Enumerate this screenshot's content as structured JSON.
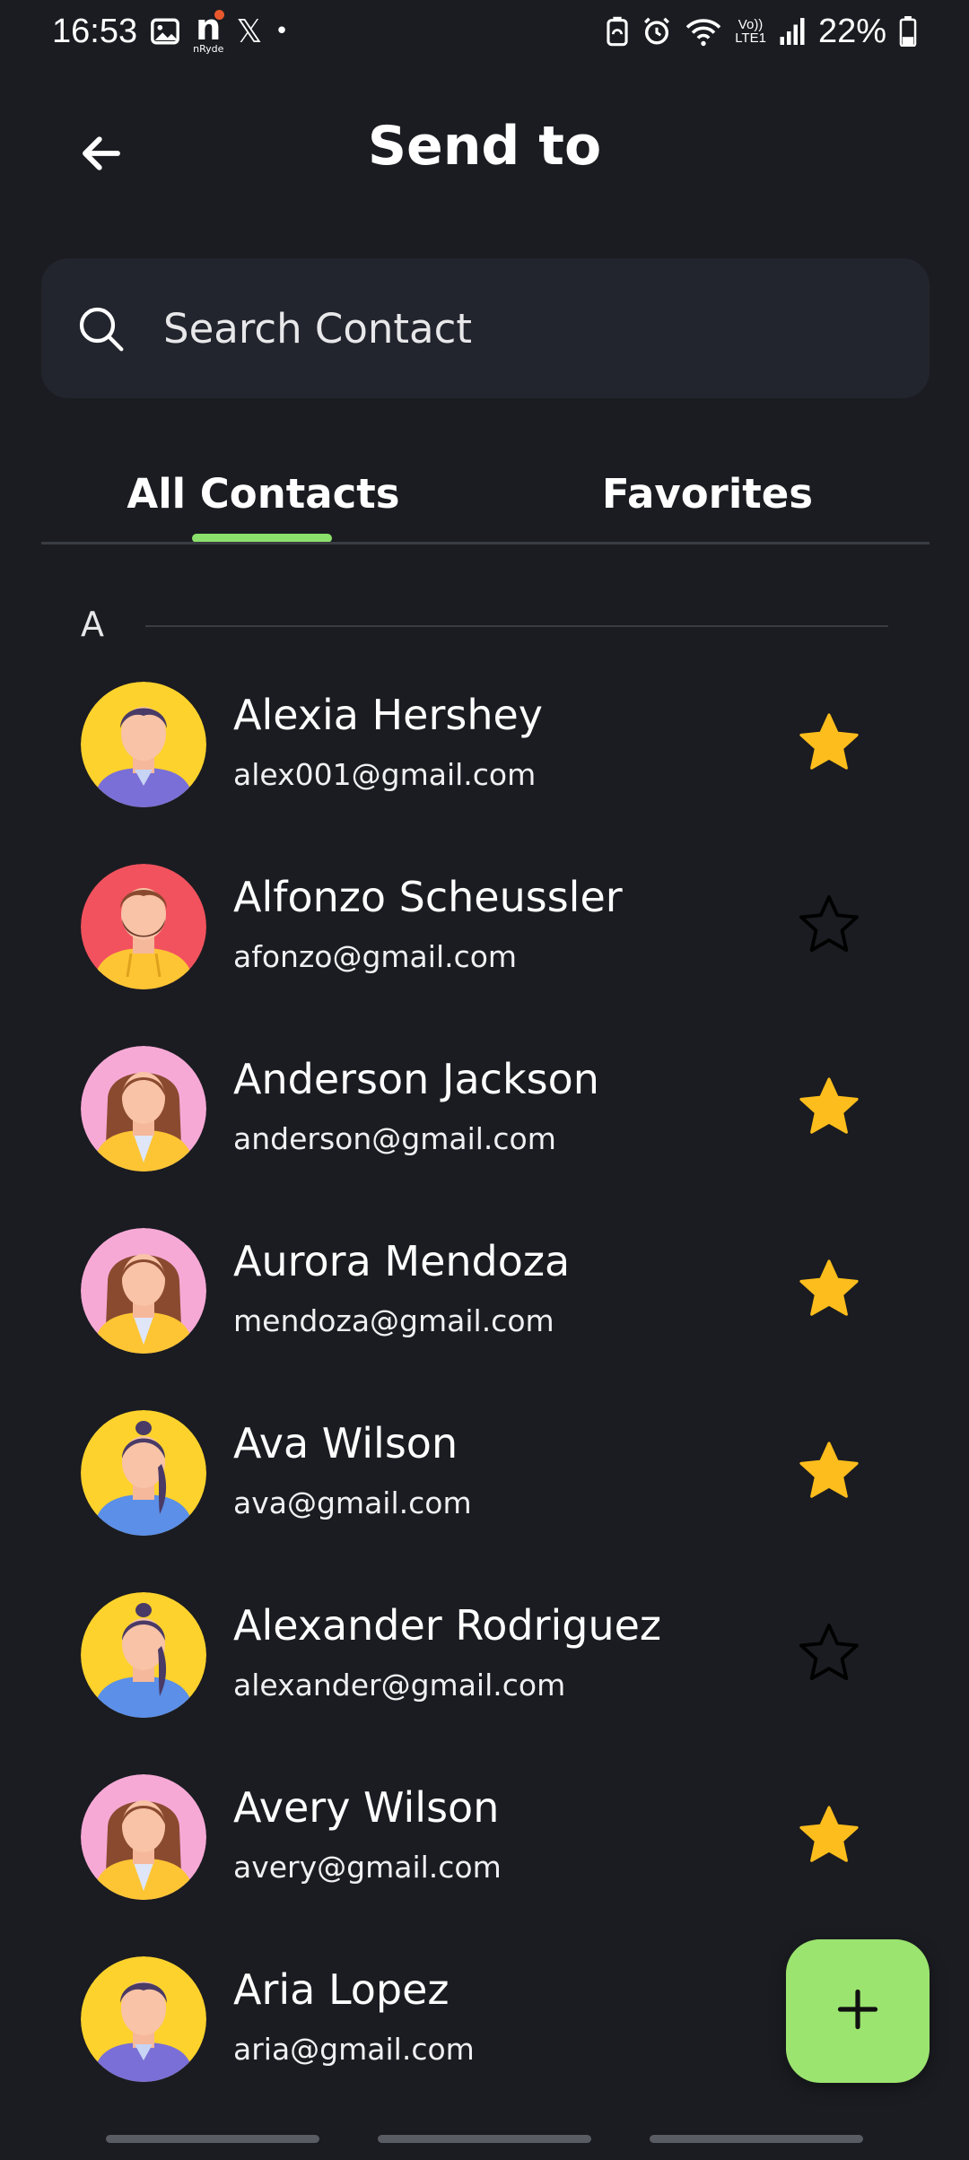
{
  "status_bar": {
    "time": "16:53",
    "nryde_letter": "n",
    "nryde_label": "nRyde",
    "x_label": "𝕏",
    "dot": "•",
    "network_label_top": "Vo))",
    "network_label_bottom": "LTE1",
    "battery_percent": "22%",
    "icons": [
      "gallery-icon",
      "nryde-app-icon",
      "x-app-icon",
      "notification-dot-icon",
      "battery-saver-icon",
      "alarm-icon",
      "wifi-icon",
      "volte-icon",
      "signal-icon",
      "battery-icon"
    ]
  },
  "header": {
    "title": "Send to",
    "back_icon": "arrow-left-icon"
  },
  "search": {
    "placeholder": "Search Contact",
    "value": "",
    "icon": "search-icon"
  },
  "tabs": [
    {
      "label": "All Contacts",
      "active": true
    },
    {
      "label": "Favorites",
      "active": false
    }
  ],
  "section": {
    "letter": "A"
  },
  "contacts": [
    {
      "name": "Alexia Hershey",
      "email": "alex001@gmail.com",
      "favorite": true,
      "avatar": "man-purple-shirt-avatar"
    },
    {
      "name": "Alfonzo Scheussler",
      "email": "afonzo@gmail.com",
      "favorite": false,
      "avatar": "bearded-man-yellow-hoodie-avatar"
    },
    {
      "name": "Anderson Jackson",
      "email": "anderson@gmail.com",
      "favorite": true,
      "avatar": "woman-yellow-jacket-avatar"
    },
    {
      "name": "Aurora Mendoza",
      "email": "mendoza@gmail.com",
      "favorite": true,
      "avatar": "woman-yellow-jacket-avatar"
    },
    {
      "name": "Ava Wilson",
      "email": "ava@gmail.com",
      "favorite": true,
      "avatar": "woman-ponytail-blue-shirt-avatar"
    },
    {
      "name": "Alexander Rodriguez",
      "email": "alexander@gmail.com",
      "favorite": false,
      "avatar": "woman-ponytail-blue-shirt-avatar"
    },
    {
      "name": "Avery Wilson",
      "email": "avery@gmail.com",
      "favorite": true,
      "avatar": "woman-yellow-jacket-avatar"
    },
    {
      "name": "Aria Lopez",
      "email": "aria@gmail.com",
      "favorite": null,
      "avatar": "man-purple-shirt-avatar"
    }
  ],
  "fab": {
    "label": "+",
    "icon": "plus-icon"
  },
  "colors": {
    "background": "#1b1c21",
    "search_bg": "#22252d",
    "accent": "#8be06b",
    "fab": "#9be46f",
    "star_filled": "#fdbd1c"
  }
}
